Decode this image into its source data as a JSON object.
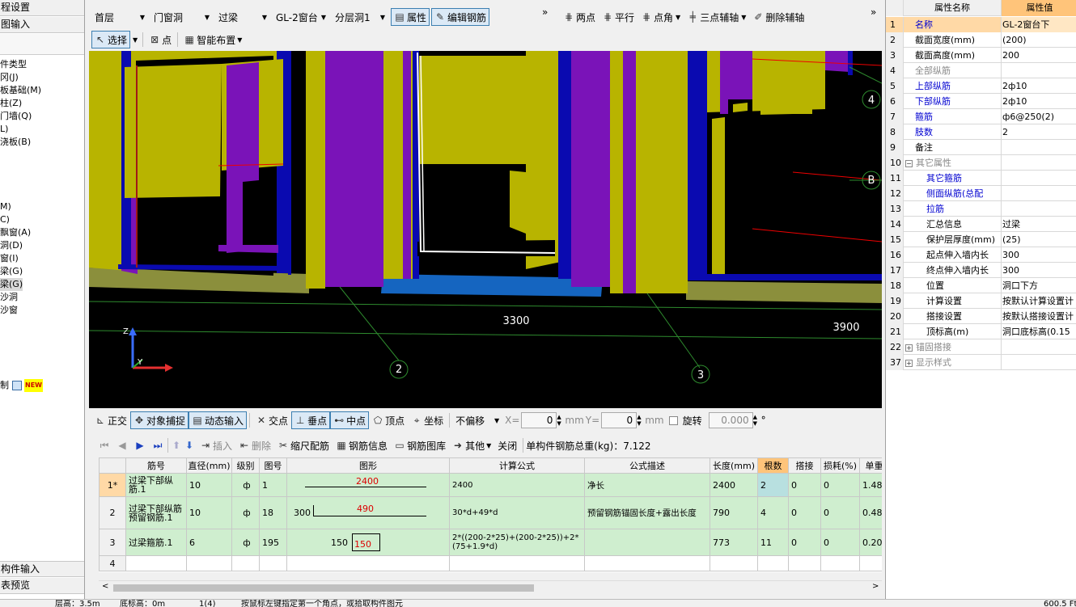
{
  "left_panel": {
    "top_items": [
      "程设置",
      "图输入"
    ],
    "tree_items": [
      "件类型",
      "冈(J)",
      "板基础(M)",
      "柱(Z)",
      "门墙(Q)",
      "L)",
      "浇板(B)",
      "M)",
      "C)",
      "飘窗(A)",
      "洞(D)",
      "窗(I)",
      "梁(G)",
      "梁(G)",
      "沙洞",
      "沙窗"
    ],
    "selected_index": 13,
    "extra_label": "制",
    "new_badge": "NEW",
    "bottom_items": [
      "构件输入",
      "表预览"
    ]
  },
  "toolbar1": {
    "floor": "首层",
    "category": "门窗洞",
    "type": "过梁",
    "element": "GL-2窗台",
    "layer": "分层洞1",
    "btn_property": "属性",
    "btn_edit_rebar": "编辑钢筋",
    "more": "»"
  },
  "toolbar_axis": {
    "two_points": "两点",
    "parallel": "平行",
    "point_angle": "点角",
    "three_point_axis": "三点辅轴",
    "delete_axis": "删除辅轴",
    "more": "»"
  },
  "toolbar2": {
    "select": "选择",
    "point": "点",
    "smart_layout": "智能布置"
  },
  "viewport": {
    "dim_left": "3300",
    "dim_right": "3900",
    "axis_2": "2",
    "axis_3": "3",
    "axis_4": "4",
    "axis_b": "B",
    "axis_z": "Z",
    "axis_y": "Y"
  },
  "snap_bar": {
    "ortho": "正交",
    "object_snap": "对象捕捉",
    "dynamic_input": "动态输入",
    "intersection": "交点",
    "perpendicular": "垂点",
    "midpoint": "中点",
    "vertex": "顶点",
    "coordinate": "坐标",
    "offset_mode": "不偏移",
    "x_label": "X=",
    "x_value": "0",
    "y_label": "Y=",
    "y_value": "0",
    "unit": "mm",
    "rotate": "旋转",
    "rotate_value": "0.000",
    "degree": "°"
  },
  "rebar_toolbar": {
    "insert": "插入",
    "delete": "删除",
    "scale_rebar": "缩尺配筋",
    "rebar_info": "钢筋信息",
    "rebar_library": "钢筋图库",
    "other": "其他",
    "close": "关闭",
    "total_weight_label": "单构件钢筋总重(kg)：7.122"
  },
  "rebar_table": {
    "headers": [
      "筋号",
      "直径(mm)",
      "级别",
      "图号",
      "图形",
      "计算公式",
      "公式描述",
      "长度(mm)",
      "根数",
      "搭接",
      "损耗(%)",
      "单重"
    ],
    "rows": [
      {
        "rn": "1*",
        "name": "过梁下部纵筋.1",
        "dia": "10",
        "grade": "ф",
        "fig": "1",
        "shape_main": "2400",
        "shape_left": "",
        "formula": "2400",
        "desc": "净长",
        "len": "2400",
        "count": "2",
        "lap": "0",
        "loss": "0",
        "unit": "1.48"
      },
      {
        "rn": "2",
        "name": "过梁下部纵筋预留钢筋.1",
        "dia": "10",
        "grade": "ф",
        "fig": "18",
        "shape_main": "490",
        "shape_left": "300",
        "formula": "30*d+49*d",
        "desc": "预留钢筋锚固长度+露出长度",
        "len": "790",
        "count": "4",
        "lap": "0",
        "loss": "0",
        "unit": "0.48"
      },
      {
        "rn": "3",
        "name": "过梁箍筋.1",
        "dia": "6",
        "grade": "ф",
        "fig": "195",
        "shape_main": "150",
        "shape_left": "150",
        "formula": "2*((200-2*25)+(200-2*25))+2*(75+1.9*d)",
        "desc": "",
        "len": "773",
        "count": "11",
        "lap": "0",
        "loss": "0",
        "unit": "0.20"
      },
      {
        "rn": "4",
        "name": "",
        "dia": "",
        "grade": "",
        "fig": "",
        "shape_main": "",
        "shape_left": "",
        "formula": "",
        "desc": "",
        "len": "",
        "count": "",
        "lap": "",
        "loss": "",
        "unit": ""
      }
    ]
  },
  "properties": {
    "header_name": "属性名称",
    "header_value": "属性值",
    "rows": [
      {
        "n": "1",
        "k": "名称",
        "v": "GL-2窗台下",
        "style": "blue"
      },
      {
        "n": "2",
        "k": "截面宽度(mm)",
        "v": "(200)",
        "style": ""
      },
      {
        "n": "3",
        "k": "截面高度(mm)",
        "v": "200",
        "style": ""
      },
      {
        "n": "4",
        "k": "全部纵筋",
        "v": "",
        "style": "gray"
      },
      {
        "n": "5",
        "k": "上部纵筋",
        "v": "2ф10",
        "style": "blue"
      },
      {
        "n": "6",
        "k": "下部纵筋",
        "v": "2ф10",
        "style": "blue"
      },
      {
        "n": "7",
        "k": "箍筋",
        "v": "ф6@250(2)",
        "style": "blue"
      },
      {
        "n": "8",
        "k": "肢数",
        "v": "2",
        "style": "blue"
      },
      {
        "n": "9",
        "k": "备注",
        "v": "",
        "style": ""
      },
      {
        "n": "10",
        "k": "其它属性",
        "v": "",
        "style": "group"
      },
      {
        "n": "11",
        "k": "其它箍筋",
        "v": "",
        "style": "blue-indent"
      },
      {
        "n": "12",
        "k": "侧面纵筋(总配",
        "v": "",
        "style": "blue-indent"
      },
      {
        "n": "13",
        "k": "拉筋",
        "v": "",
        "style": "blue-indent"
      },
      {
        "n": "14",
        "k": "汇总信息",
        "v": "过梁",
        "style": "indent"
      },
      {
        "n": "15",
        "k": "保护层厚度(mm)",
        "v": "(25)",
        "style": "indent"
      },
      {
        "n": "16",
        "k": "起点伸入墙内长",
        "v": "300",
        "style": "indent"
      },
      {
        "n": "17",
        "k": "终点伸入墙内长",
        "v": "300",
        "style": "indent"
      },
      {
        "n": "18",
        "k": "位置",
        "v": "洞口下方",
        "style": "indent"
      },
      {
        "n": "19",
        "k": "计算设置",
        "v": "按默认计算设置计",
        "style": "indent"
      },
      {
        "n": "20",
        "k": "搭接设置",
        "v": "按默认搭接设置计",
        "style": "indent"
      },
      {
        "n": "21",
        "k": "顶标高(m)",
        "v": "洞口底标高(0.15",
        "style": "indent"
      },
      {
        "n": "22",
        "k": "锚固搭接",
        "v": "",
        "style": "group-plus"
      },
      {
        "n": "37",
        "k": "显示样式",
        "v": "",
        "style": "group-plus"
      }
    ]
  },
  "status": {
    "floor_height": "层高：3.5m",
    "base_elev": "底标高：0m",
    "count": "1(4)",
    "hint": "按鼠标左键指定第一个角点，或拾取构件图元",
    "coords": "600.5 Ft"
  }
}
